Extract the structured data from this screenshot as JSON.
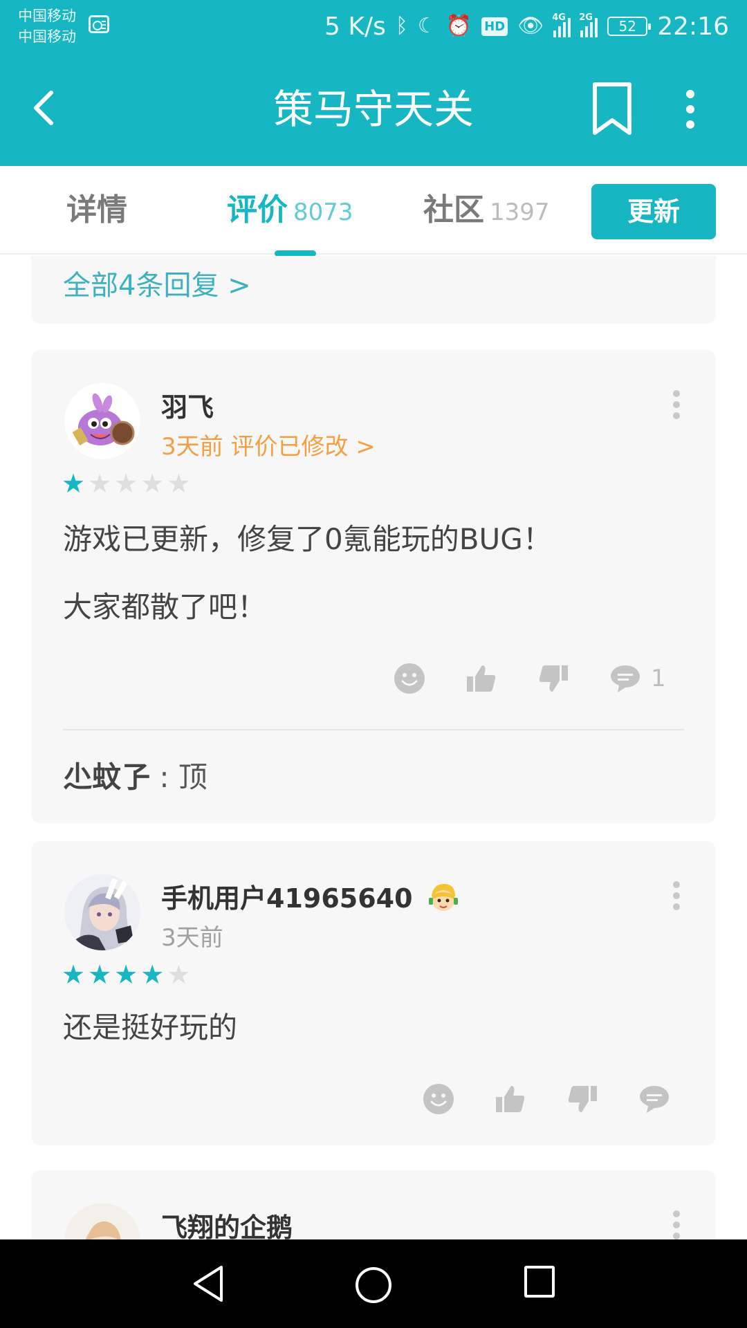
{
  "status_bar": {
    "carrier_1": "中国移动",
    "carrier_2": "中国移动",
    "speed": "5 K/s",
    "hd": "HD",
    "net_1": "4G",
    "net_2": "2G",
    "battery": "52",
    "time": "22:16"
  },
  "app_bar": {
    "title": "策马守天关"
  },
  "tabs": [
    {
      "label": "详情",
      "count": ""
    },
    {
      "label": "评价",
      "count": "8073"
    },
    {
      "label": "社区",
      "count": "1397"
    }
  ],
  "update_button": "更新",
  "prev_card": {
    "all_replies": "全部4条回复 >"
  },
  "reviews": [
    {
      "username": "羽飞",
      "meta": "3天前 评价已修改 >",
      "rating": 1,
      "max_rating": 5,
      "lines": [
        "游戏已更新，修复了0氪能玩的BUG！",
        "大家都散了吧！"
      ],
      "comment_count": "1",
      "reply": {
        "name": "尐蚊孒",
        "separator": " : ",
        "text": "顶"
      }
    },
    {
      "username": "手机用户41965640",
      "meta": "3天前",
      "rating": 4,
      "max_rating": 5,
      "lines": [
        "还是挺好玩的"
      ]
    },
    {
      "username": "飞翔的企鹅"
    }
  ],
  "colors": {
    "accent": "#17b6c3",
    "orange": "#f2a043",
    "icon_gray": "#bdbdbd"
  },
  "icons": {
    "back": "chevron-left-icon",
    "bookmark": "bookmark-icon",
    "more": "more-vertical-icon",
    "emoji": "smiley-icon",
    "like": "thumbs-up-icon",
    "dislike": "thumbs-down-icon",
    "comment": "comment-icon"
  }
}
